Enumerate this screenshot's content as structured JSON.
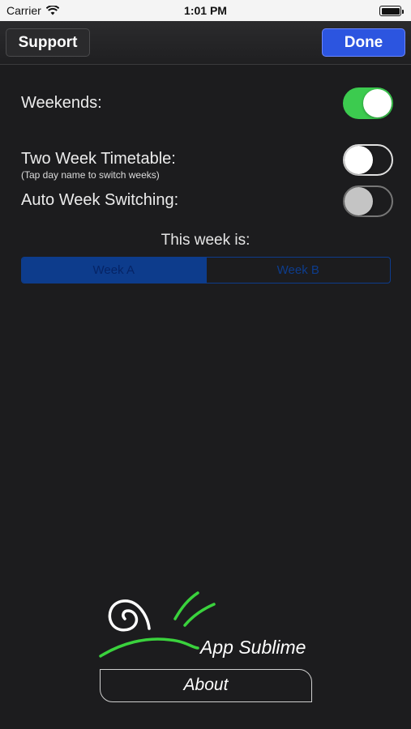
{
  "status_bar": {
    "carrier": "Carrier",
    "time": "1:01 PM"
  },
  "nav": {
    "support_label": "Support",
    "done_label": "Done"
  },
  "settings": {
    "weekends": {
      "label": "Weekends:",
      "on": true
    },
    "two_week": {
      "label": "Two Week Timetable:",
      "sublabel": "(Tap day name to switch weeks)",
      "on": false
    },
    "auto_switch": {
      "label": "Auto Week Switching:",
      "on": false,
      "enabled": false
    }
  },
  "week": {
    "title": "This week is:",
    "options": [
      "Week A",
      "Week B"
    ],
    "selected": "Week A"
  },
  "footer": {
    "brand": "App Sublime",
    "about_label": "About"
  },
  "colors": {
    "accent": "#2c55e0",
    "toggle_on": "#3ccb4f",
    "segment": "#0d3c8c"
  }
}
